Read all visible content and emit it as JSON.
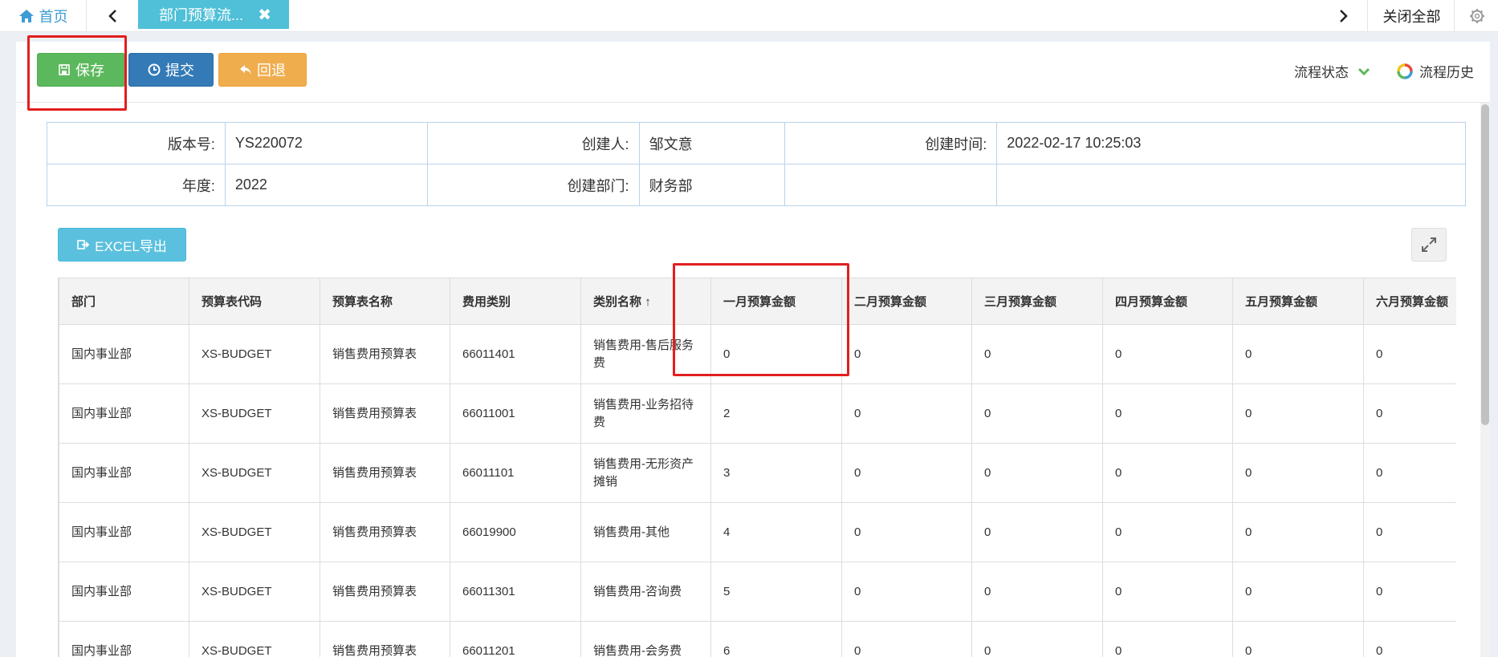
{
  "tabs": {
    "home_label": "首页",
    "active_label": "部门预算流...",
    "close_all_label": "关闭全部"
  },
  "toolbar": {
    "save_label": "保存",
    "submit_label": "提交",
    "back_label": "回退",
    "flow_status_label": "流程状态",
    "flow_history_label": "流程历史"
  },
  "info": {
    "version_label": "版本号:",
    "version_value": "YS220072",
    "creator_label": "创建人:",
    "creator_value": "邹文意",
    "created_time_label": "创建时间:",
    "created_time_value": "2022-02-17 10:25:03",
    "year_label": "年度:",
    "year_value": "2022",
    "dept_label": "创建部门:",
    "dept_value": "财务部"
  },
  "export_label": "EXCEL导出",
  "grid": {
    "columns": [
      "部门",
      "预算表代码",
      "预算表名称",
      "费用类别",
      "类别名称",
      "一月预算金额",
      "二月预算金额",
      "三月预算金额",
      "四月预算金额",
      "五月预算金额",
      "六月预算金额"
    ],
    "sort_indicator": "↑",
    "rows": [
      [
        "国内事业部",
        "XS-BUDGET",
        "销售费用预算表",
        "66011401",
        "销售费用-售后服务费",
        "0",
        "0",
        "0",
        "0",
        "0",
        "0"
      ],
      [
        "国内事业部",
        "XS-BUDGET",
        "销售费用预算表",
        "66011001",
        "销售费用-业务招待费",
        "2",
        "0",
        "0",
        "0",
        "0",
        "0"
      ],
      [
        "国内事业部",
        "XS-BUDGET",
        "销售费用预算表",
        "66011101",
        "销售费用-无形资产摊销",
        "3",
        "0",
        "0",
        "0",
        "0",
        "0"
      ],
      [
        "国内事业部",
        "XS-BUDGET",
        "销售费用预算表",
        "66019900",
        "销售费用-其他",
        "4",
        "0",
        "0",
        "0",
        "0",
        "0"
      ],
      [
        "国内事业部",
        "XS-BUDGET",
        "销售费用预算表",
        "66011301",
        "销售费用-咨询费",
        "5",
        "0",
        "0",
        "0",
        "0",
        "0"
      ],
      [
        "国内事业部",
        "XS-BUDGET",
        "销售费用预算表",
        "66011201",
        "销售费用-会务费",
        "6",
        "0",
        "0",
        "0",
        "0",
        "0"
      ]
    ]
  },
  "icons": {
    "home": "home-icon",
    "prev": "chevron-left-icon",
    "next": "chevron-right-icon",
    "close": "close-icon",
    "gear": "gear-icon",
    "save": "floppy-icon",
    "submit": "clock-icon",
    "back": "reply-icon",
    "status": "chevron-down-icon",
    "history": "ring-icon",
    "export": "export-icon",
    "expand": "expand-icon"
  },
  "colors": {
    "accent_tab": "#4fc0d8",
    "save": "#5cb85c",
    "submit": "#337ab7",
    "back": "#f0ad4e",
    "excel": "#5bc0de",
    "highlight": "#e21e1e"
  }
}
